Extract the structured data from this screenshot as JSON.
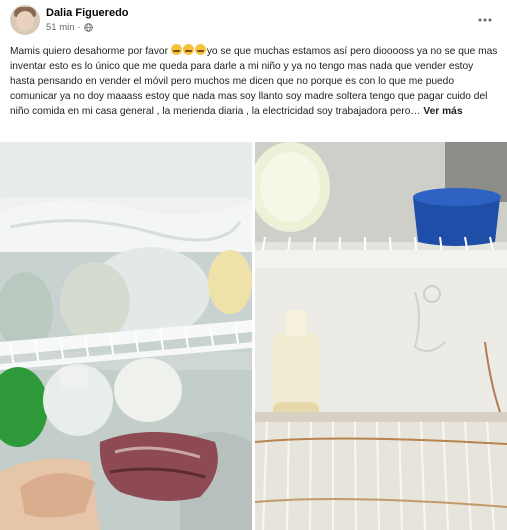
{
  "post": {
    "author": "Dalia Figueredo",
    "time": "51 min",
    "separator": "·",
    "privacy_icon": "globe-icon",
    "more_icon": "more-dots-icon",
    "text_lead": "Mamis quiero desahorme por favor",
    "text_body": "yo se que muchas estamos así pero diooooss ya no se que mas inventar esto es lo único que me queda para darle a mi niño y ya no tengo mas nada que vender estoy hasta pensando en vender el móvil pero muchos me dicen que no porque es con lo que me puedo comunicar ya no doy maaass estoy que nada mas soy llanto soy madre soltera tengo que pagar cuido del niño comida en mi casa general , la merienda diaria , la electricidad soy trabajadora pero…",
    "see_more": "Ver más",
    "emoji_icon": "crying-emoji-icon",
    "emoji_count": 3
  },
  "photos": [
    {
      "name": "fridge-photo-left",
      "subject": "freezer-and-shelves"
    },
    {
      "name": "fridge-photo-right",
      "subject": "empty-fridge-shelves"
    }
  ],
  "colors": {
    "text": "#1c1e21",
    "meta": "#65676b",
    "background": "#ffffff"
  }
}
